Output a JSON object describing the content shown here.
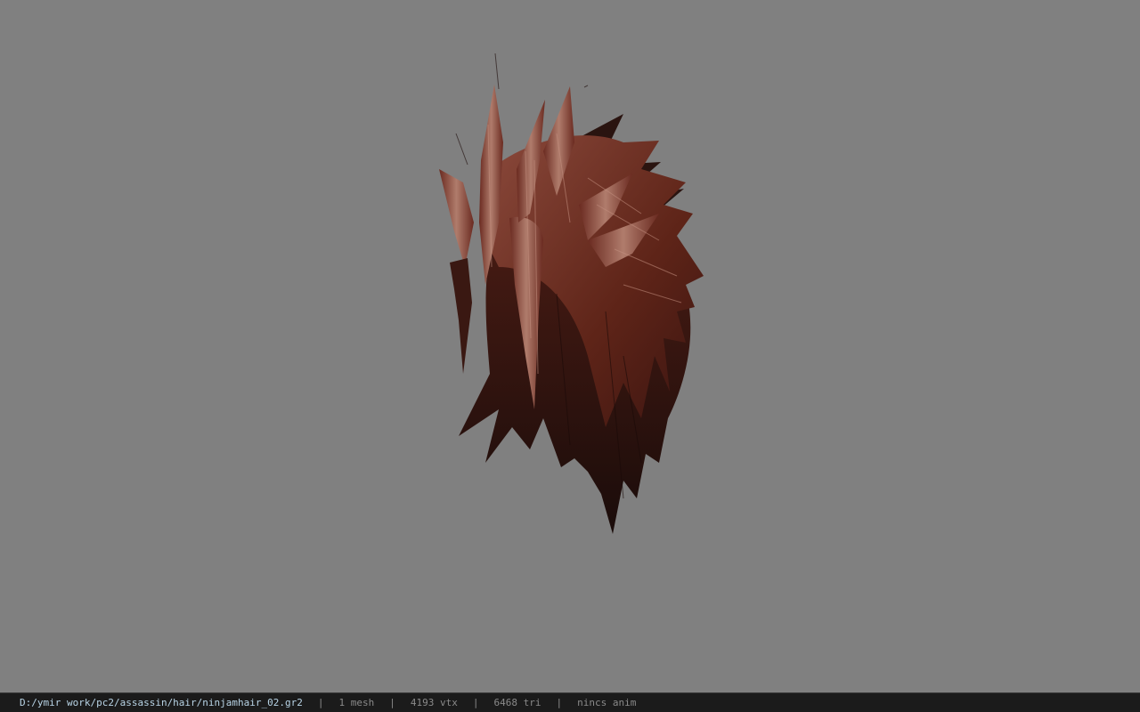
{
  "status_bar": {
    "file_path": "D:/ymir work/pc2/assassin/hair/ninjamhair_02.gr2",
    "separator": "|",
    "mesh_count": "1 mesh",
    "vertex_count": "4193 vtx",
    "triangle_count": "6468 tri",
    "animation": "nincs anim"
  },
  "viewport": {
    "background_color": "#808080",
    "model_subject": "hair-mesh"
  },
  "colors": {
    "status_bg": "#1b1b1b",
    "path_text": "#b8d4e6",
    "stat_text": "#8a8a8a",
    "hair_dark": "#2a1210",
    "hair_mid": "#5e2418",
    "hair_light": "#a0685a"
  }
}
